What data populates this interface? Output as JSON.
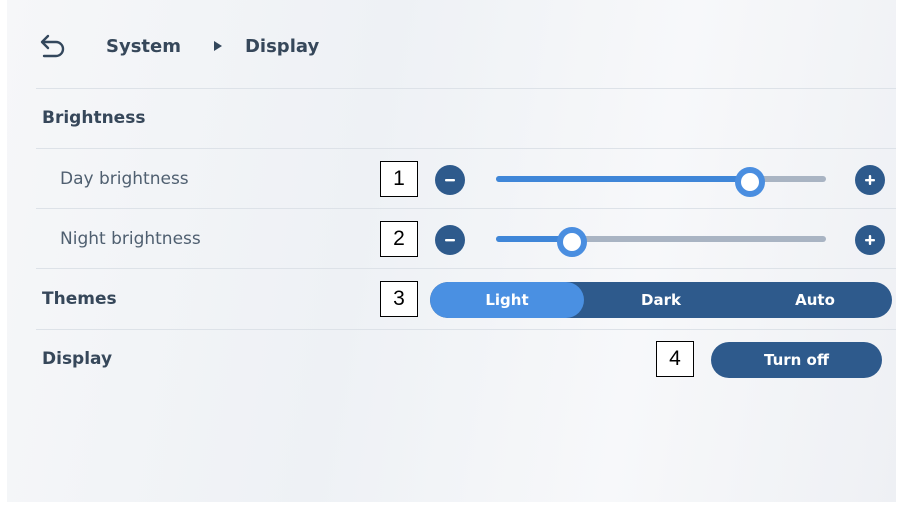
{
  "breadcrumb": {
    "parent": "System",
    "current": "Display"
  },
  "sections": {
    "brightness": {
      "title": "Brightness",
      "day": {
        "label": "Day brightness",
        "marker": "1",
        "value_fraction": 0.77
      },
      "night": {
        "label": "Night brightness",
        "marker": "2",
        "value_fraction": 0.23
      }
    },
    "themes": {
      "title": "Themes",
      "marker": "3",
      "options": [
        "Light",
        "Dark",
        "Auto"
      ],
      "selected": "Light"
    },
    "display": {
      "title": "Display",
      "marker": "4",
      "button_label": "Turn off"
    }
  },
  "colors": {
    "accent": "#4a90e2",
    "primary": "#2e5a8c",
    "track": "#a9b4c3"
  },
  "icons": {
    "back": "back-arrow-icon",
    "separator": "triangle-right-icon",
    "decrease": "minus-icon",
    "increase": "plus-icon"
  }
}
